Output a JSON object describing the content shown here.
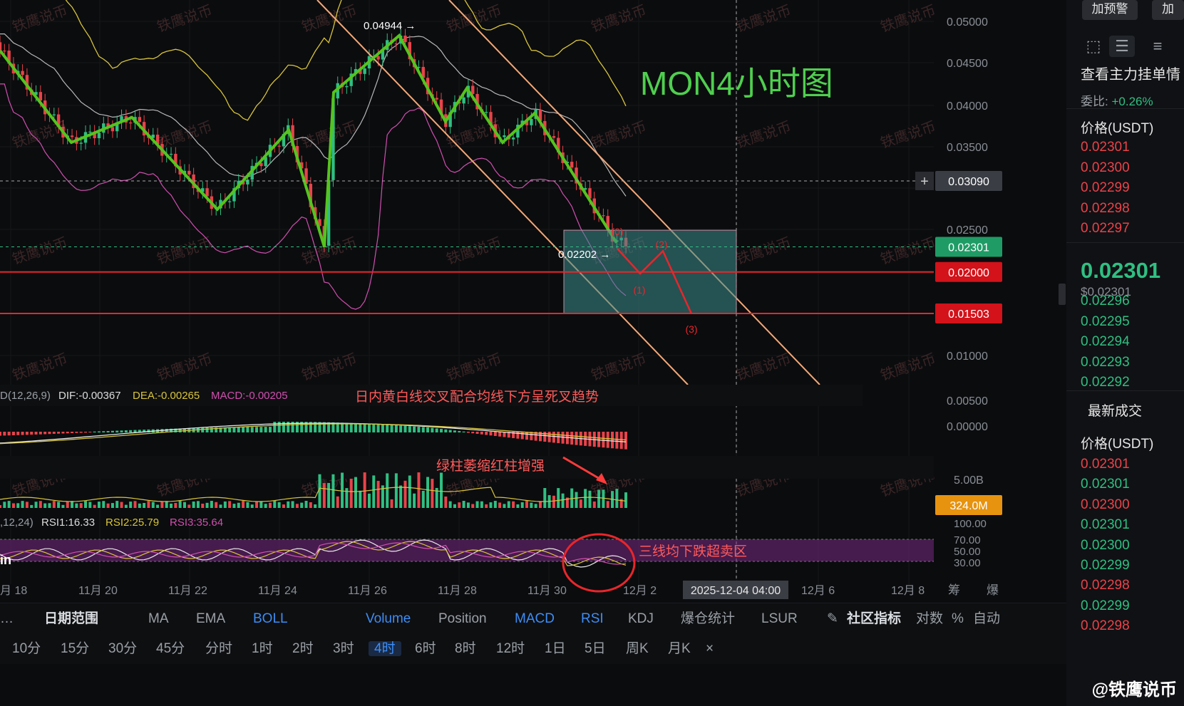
{
  "chart_data": {
    "type": "candlestick",
    "title": "MON4小时图",
    "price_axis": {
      "ylim": [
        0.0075,
        0.0525
      ],
      "ticks": [
        "0.05000",
        "0.04500",
        "0.04000",
        "0.03500",
        "0.02500",
        "0.01000",
        "0.00500",
        "0.00000"
      ]
    },
    "date_axis": [
      "月 18",
      "11月 20",
      "11月 22",
      "11月 24",
      "11月 26",
      "11月 28",
      "11月 30",
      "12月 2",
      "12月 6",
      "12月 8"
    ],
    "crosshair_date": "2025-12-04 04:00",
    "crosshair_price": "0.03090",
    "last_price": "0.02301",
    "levels": [
      {
        "label": "0.02000",
        "value": 0.02
      },
      {
        "label": "0.01503",
        "value": 0.01503
      }
    ],
    "high_marker": "0.04944",
    "low_marker": "0.02202",
    "zigzag": [
      0.0465,
      0.0355,
      0.0385,
      0.0275,
      0.037,
      0.023,
      0.0415,
      0.0483,
      0.038,
      0.042,
      0.0355,
      0.039,
      0.0235
    ],
    "projection_labels": [
      "(1)",
      "(2)",
      "(3)",
      "(0)"
    ],
    "projection": [
      0.0228,
      0.0198,
      0.0225,
      0.015
    ],
    "macd": {
      "label_left": "D(12,26,9)",
      "dif": "DIF:-0.00367",
      "dea": "DEA:-0.00265",
      "macd": "MACD:-0.00205",
      "ticks": [
        "0.00500",
        "0.00000"
      ],
      "note": "日内黄白线交叉配合均线下方呈死叉趋势"
    },
    "volume": {
      "ticks": [
        "5.00B"
      ],
      "last": "324.0M",
      "note": "绿柱萎缩红柱增强"
    },
    "rsi": {
      "label_left": ",12,24)",
      "rsi1": "RSI1:16.33",
      "rsi2": "RSI2:25.79",
      "rsi3": "RSI3:35.64",
      "ticks": [
        "100.00",
        "70.00",
        "50.00",
        "30.00"
      ],
      "note": "三线均下跌超卖区",
      "tag": "in"
    },
    "watermark": "铁鹰说币",
    "extra_labels": [
      "筹",
      "爆"
    ]
  },
  "toolbar1": {
    "dots": "…",
    "range": "日期范围",
    "items": [
      "MA",
      "EMA",
      "BOLL",
      "Volume",
      "Position",
      "MACD",
      "RSI",
      "KDJ",
      "爆仓统计",
      "LSUR"
    ],
    "community": "社区指标",
    "log": "对数",
    "pct": "%",
    "auto": "自动"
  },
  "toolbar2": {
    "items": [
      "10分",
      "15分",
      "30分",
      "45分",
      "分时",
      "1时",
      "2时",
      "3时",
      "4时",
      "6时",
      "8时",
      "12时",
      "1日",
      "5日",
      "周K",
      "月K"
    ],
    "selected": "4时",
    "close": "×"
  },
  "sidebar": {
    "alert_btn": "加预警",
    "alert_btn2": "加",
    "orderbook_title": "查看主力挂单情",
    "ratio_label": "委比:",
    "ratio_value": "+0.26%",
    "price_header": "价格(USDT)",
    "asks": [
      "0.02301",
      "0.02300",
      "0.02299",
      "0.02298",
      "0.02297"
    ],
    "last_price": "0.02301",
    "last_usd": "$0.02301",
    "bids": [
      "0.02296",
      "0.02295",
      "0.02294",
      "0.02293",
      "0.02292"
    ],
    "trades_title": "最新成交",
    "trades_header": "价格(USDT)",
    "trades": [
      {
        "p": "0.02301",
        "side": "sell"
      },
      {
        "p": "0.02301",
        "side": "buy"
      },
      {
        "p": "0.02300",
        "side": "sell"
      },
      {
        "p": "0.02301",
        "side": "buy"
      },
      {
        "p": "0.02300",
        "side": "buy"
      },
      {
        "p": "0.02299",
        "side": "buy"
      },
      {
        "p": "0.02298",
        "side": "sell"
      },
      {
        "p": "0.02299",
        "side": "buy"
      },
      {
        "p": "0.02298",
        "side": "sell"
      }
    ]
  },
  "footer_watermark": "@铁鹰说币",
  "colors": {
    "up": "#2fbf82",
    "down": "#e8434a",
    "accent": "#3d8df5",
    "zigzag": "#55c41e",
    "channel": "#f4a877",
    "boll_upper": "#d8c43a",
    "boll_mid": "#b8b8b8",
    "boll_lower": "#d04fb0"
  }
}
